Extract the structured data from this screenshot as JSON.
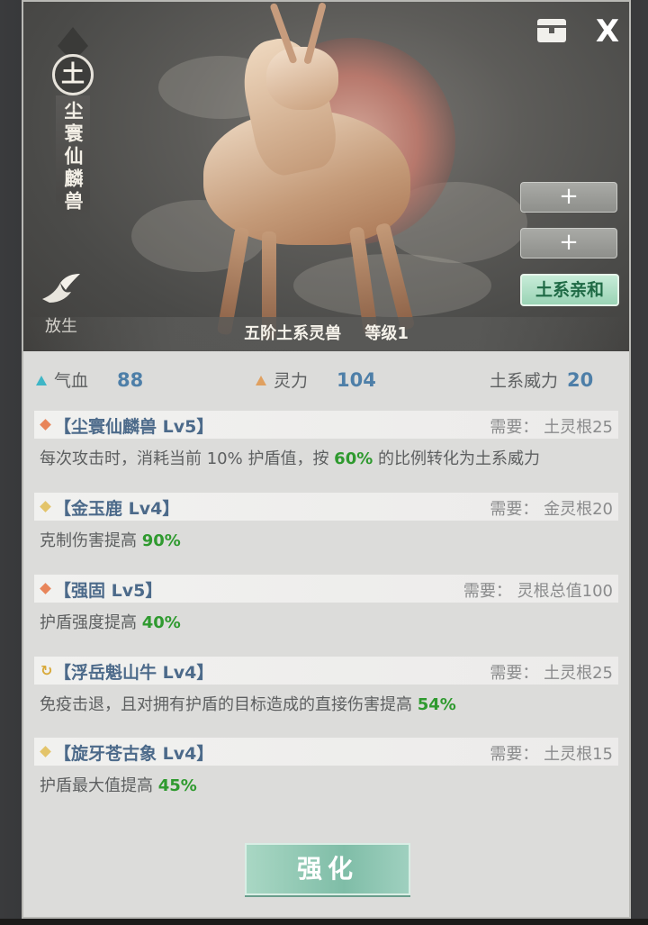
{
  "header": {
    "element_char": "土",
    "beast_name": "尘寰仙麟兽",
    "release_label": "放生",
    "plus_label": "+",
    "affinity_label": "土系亲和",
    "tier_text": "五阶土系灵兽",
    "level_text": "等级1",
    "close_label": "X"
  },
  "stats": [
    {
      "label": "气血",
      "value": "88",
      "color": "#3fb6c6"
    },
    {
      "label": "灵力",
      "value": "104",
      "color": "#e0a060"
    },
    {
      "label": "土系威力",
      "value": "20"
    }
  ],
  "skills": [
    {
      "name": "【尘寰仙麟兽 Lv5】",
      "requirement": "需要：  土灵根25",
      "marker": "diamond",
      "marker_color": "#e8855a",
      "desc_pre": "每次攻击时，消耗当前 10% 护盾值，按 ",
      "desc_hl": "60%",
      "desc_post": " 的比例转化为土系威力"
    },
    {
      "name": "【金玉鹿 Lv4】",
      "requirement": "需要：  金灵根20",
      "marker": "diamond",
      "marker_color": "#e3c46a",
      "desc_pre": "克制伤害提高 ",
      "desc_hl": "90%",
      "desc_post": ""
    },
    {
      "name": "【强固 Lv5】",
      "requirement": "需要：  灵根总值100",
      "marker": "diamond",
      "marker_color": "#e8855a",
      "desc_pre": "护盾强度提高 ",
      "desc_hl": "40%",
      "desc_post": ""
    },
    {
      "name": "【浮岳魁山牛 Lv4】",
      "requirement": "需要：  土灵根25",
      "marker": "refresh",
      "marker_color": "#d8a93a",
      "desc_pre": "免疫击退，且对拥有护盾的目标造成的直接伤害提高 ",
      "desc_hl": "54%",
      "desc_post": ""
    },
    {
      "name": "【旋牙苍古象 Lv4】",
      "requirement": "需要：  土灵根15",
      "marker": "diamond",
      "marker_color": "#e3c46a",
      "desc_pre": "护盾最大值提高 ",
      "desc_hl": "45%",
      "desc_post": ""
    }
  ],
  "footer": {
    "enhance_label": "强化"
  }
}
